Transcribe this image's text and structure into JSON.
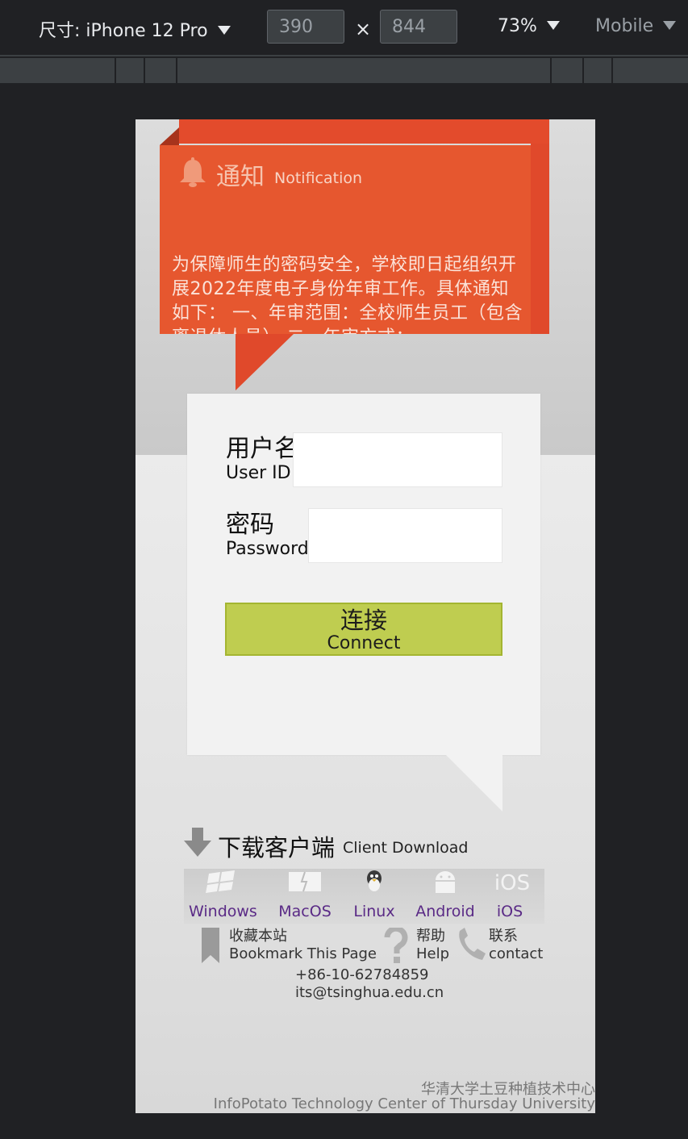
{
  "devtools": {
    "device_label": "尺寸: iPhone 12 Pro",
    "width_value": "390",
    "height_value": "844",
    "times_sign": "×",
    "zoom": "73%",
    "mode": "Mobile"
  },
  "notice": {
    "icon": "bell-icon",
    "title_zh": "通知",
    "title_en": "Notification",
    "body": "为保障师生的密码安全，学校即日起组织开展2022年度电子身份年审工作。具体通知如下： 一、年审范围：全校师生员工（包含离退休人员） 二、年审方式："
  },
  "login": {
    "username_label_zh": "用户名",
    "username_label_en": "User ID",
    "username_value": "",
    "password_label_zh": "密码",
    "password_label_en": "Password",
    "password_value": "",
    "connect_zh": "连接",
    "connect_en": "Connect"
  },
  "download": {
    "title_zh": "下载客户端",
    "title_en": "Client Download",
    "clients": [
      {
        "label": "Windows",
        "icon": "windows-icon"
      },
      {
        "label": "MacOS",
        "icon": "macos-icon"
      },
      {
        "label": "Linux",
        "icon": "linux-icon"
      },
      {
        "label": "Android",
        "icon": "android-icon"
      },
      {
        "label": "iOS",
        "icon": "ios-icon"
      }
    ]
  },
  "links": {
    "bookmark_zh": "收藏本站",
    "bookmark_en": "Bookmark This Page",
    "help_zh": "帮助",
    "help_en": "Help",
    "contact_zh": "联系",
    "contact_en": "contact",
    "phone": "+86-10-62784859",
    "email": "its@tsinghua.edu.cn"
  },
  "footer": {
    "org_zh": "华清大学土豆种植技术中心",
    "org_en": "InfoPotato Technology Center of Thursday University"
  },
  "colors": {
    "notice": "#e6572f",
    "connect": "#bfcd50",
    "link": "#5a2a86"
  }
}
